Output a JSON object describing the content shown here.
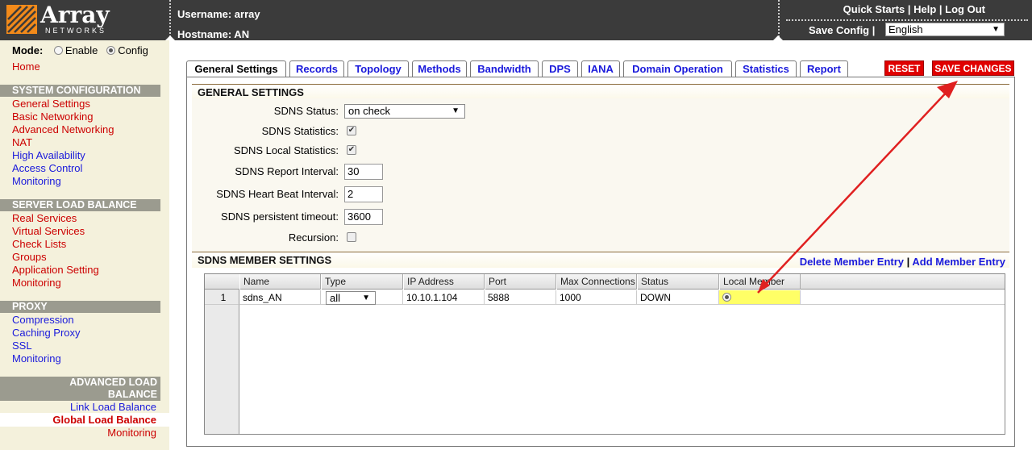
{
  "header": {
    "logo_word": "Array",
    "logo_sub": "NETWORKS",
    "username_line": "Username: array",
    "hostname_line": "Hostname: AN",
    "quick_starts": "Quick Starts",
    "help": "Help",
    "log_out": "Log Out",
    "save_config": "Save Config |",
    "language": "English"
  },
  "sidebar": {
    "mode_label": "Mode:",
    "mode_enable": "Enable",
    "mode_config": "Config",
    "home": "Home",
    "system_config": {
      "title": "SYSTEM CONFIGURATION",
      "items": [
        "General Settings",
        "Basic Networking",
        "Advanced Networking",
        "NAT",
        "High Availability",
        "Access Control",
        "Monitoring"
      ]
    },
    "slb": {
      "title": "SERVER LOAD BALANCE",
      "items": [
        "Real Services",
        "Virtual Services",
        "Check Lists",
        "Groups",
        "Application Setting",
        "Monitoring"
      ]
    },
    "proxy": {
      "title": "PROXY",
      "items": [
        "Compression",
        "Caching Proxy",
        "SSL",
        "Monitoring"
      ]
    },
    "alb": {
      "title_line1": "ADVANCED LOAD",
      "title_line2": "BALANCE",
      "items": [
        "Link Load Balance",
        "Global Load Balance",
        "Monitoring"
      ]
    }
  },
  "tabs": [
    "General Settings",
    "Records",
    "Topology",
    "Methods",
    "Bandwidth",
    "DPS",
    "IANA",
    "Domain Operation",
    "Statistics",
    "Report"
  ],
  "buttons": {
    "reset": "RESET",
    "save_changes": "SAVE CHANGES"
  },
  "general": {
    "title": "GENERAL SETTINGS",
    "sdns_status_label": "SDNS Status:",
    "sdns_status_value": "on check",
    "sdns_statistics_label": "SDNS Statistics:",
    "sdns_local_statistics_label": "SDNS Local Statistics:",
    "report_interval_label": "SDNS Report Interval:",
    "report_interval_value": "30",
    "heart_beat_label": "SDNS Heart Beat Interval:",
    "heart_beat_value": "2",
    "persistent_timeout_label": "SDNS persistent timeout:",
    "persistent_timeout_value": "3600",
    "recursion_label": "Recursion:"
  },
  "member": {
    "title": "SDNS MEMBER SETTINGS",
    "delete_link": "Delete Member Entry",
    "add_link": "Add Member Entry",
    "columns": [
      "Name",
      "Type",
      "IP Address",
      "Port",
      "Max Connections",
      "Status",
      "Local Member"
    ],
    "rows": [
      {
        "index": "1",
        "name": "sdns_AN",
        "type": "all",
        "ip": "10.10.1.104",
        "port": "5888",
        "max_connections": "1000",
        "status": "DOWN"
      }
    ]
  },
  "colors": {
    "accent_red": "#e00000",
    "link_blue": "#1a1adb",
    "sidebar_bg": "#f4f1dc",
    "header_bg": "#3b3b3b",
    "highlight_yellow": "#ffff66"
  }
}
